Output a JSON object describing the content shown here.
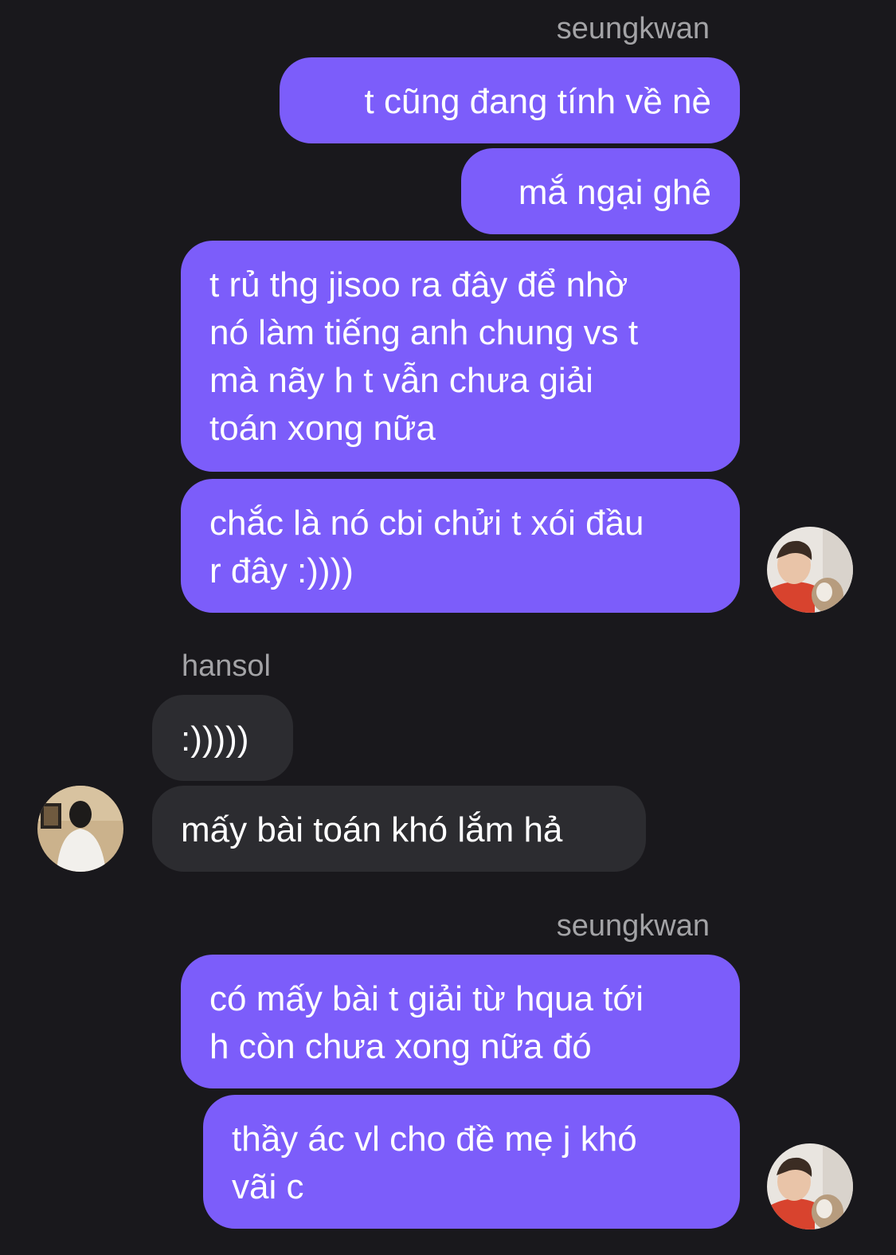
{
  "colors": {
    "background": "#19181c",
    "outgoing_bubble": "#7c5dfa",
    "incoming_bubble": "#2c2c30",
    "sender_name": "#a3a3a6",
    "message_text": "#ffffff"
  },
  "thread": {
    "group1": {
      "sender": "seungkwan",
      "messages": [
        "t cũng đang tính về nè",
        "mắ ngại ghê",
        "t rủ thg jisoo ra đây để nhờ\nnó làm tiếng anh chung vs t\nmà nãy h t vẫn chưa giải\ntoán xong nữa",
        "chắc là nó cbi chửi t xói đầu\nr đây :))))"
      ],
      "avatar_icon": "profile-photo-seungkwan"
    },
    "group2": {
      "sender": "hansol",
      "messages": [
        ":)))))",
        "mấy bài toán khó lắm hả"
      ],
      "avatar_icon": "profile-photo-hansol"
    },
    "group3": {
      "sender": "seungkwan",
      "messages": [
        "có mấy bài t giải từ hqua tới\nh còn chưa xong nữa đó",
        "thầy ác vl cho đề mẹ j khó\nvãi c"
      ],
      "avatar_icon": "profile-photo-seungkwan"
    }
  }
}
